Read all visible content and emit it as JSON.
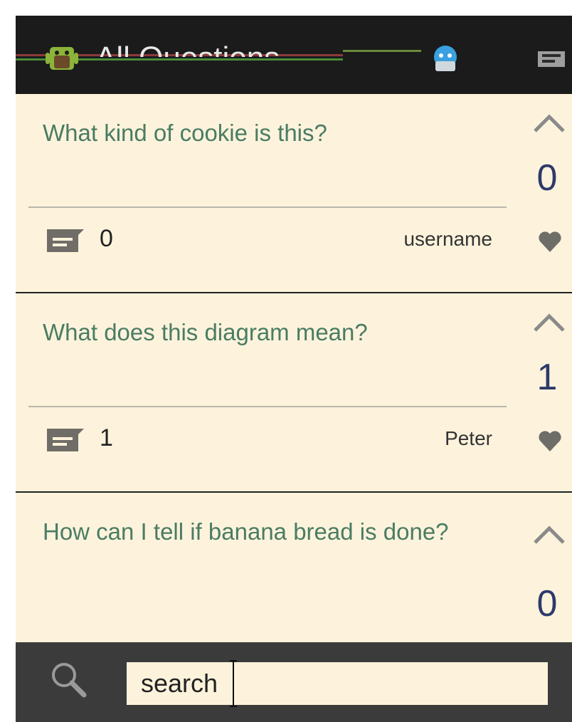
{
  "app": {
    "title": "All Questions"
  },
  "questions": [
    {
      "title": "What kind of cookie is this?",
      "comments": "0",
      "user": "username",
      "votes": "0"
    },
    {
      "title": "What does this diagram mean?",
      "comments": "1",
      "user": "Peter",
      "votes": "1"
    },
    {
      "title": "How can I tell if banana bread is done?",
      "comments": "",
      "user": "",
      "votes": "0"
    }
  ],
  "search": {
    "value": "search"
  },
  "colors": {
    "background": "#fdf3dc",
    "question_text": "#4a7c63",
    "vote_count": "#2e3a6a",
    "action_bar": "#1b1b1b",
    "search_bar": "#3b3b3b"
  },
  "icons": [
    "app-logo-icon",
    "comment-icon",
    "upvote-chevron-icon",
    "heart-icon",
    "search-icon"
  ]
}
